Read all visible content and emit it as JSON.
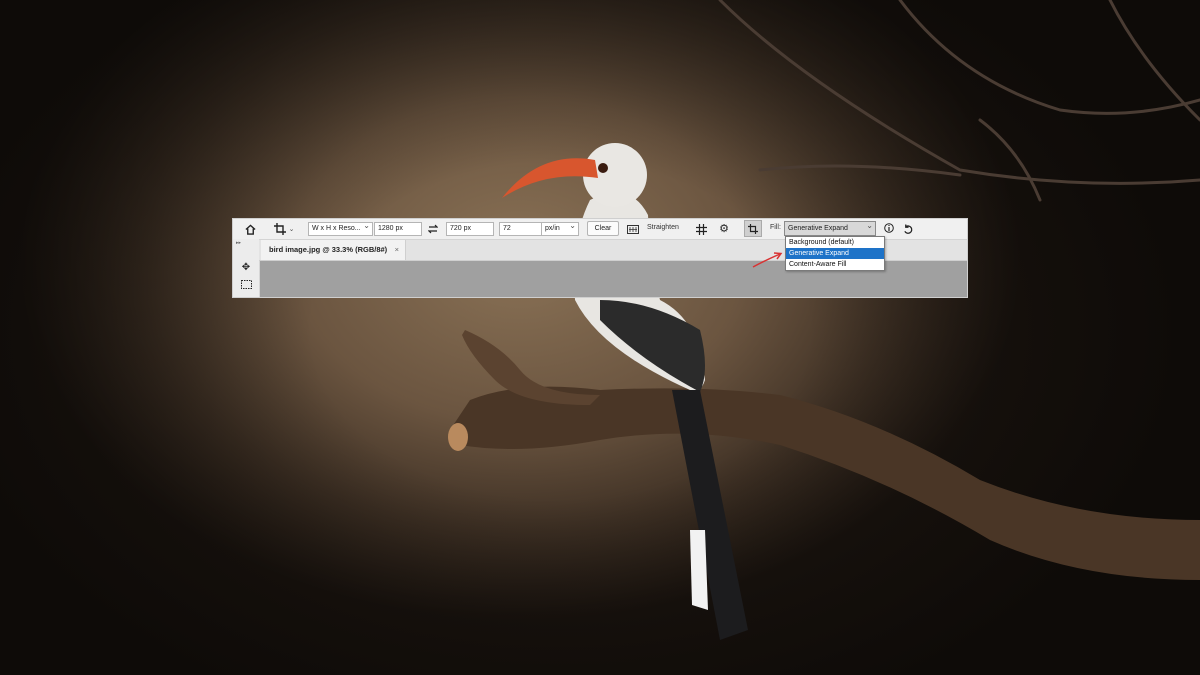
{
  "options_bar": {
    "home_icon": "home-icon",
    "crop_icon": "crop-icon",
    "ratio_preset": "W x H x Reso...",
    "width": "1280 px",
    "swap_icon": "swap-arrows-icon",
    "height": "720 px",
    "resolution": "72",
    "resolution_unit": "px/in",
    "clear_label": "Clear",
    "straighten_label": "Straighten",
    "grid_icon": "grid-overlay-icon",
    "settings_icon": "gear-icon",
    "content_aware_icon": "crop-fill-icon",
    "fill_label": "Fill:",
    "fill_value": "Generative Expand",
    "info_icon": "info-icon",
    "reset_icon": "reset-icon"
  },
  "fill_dropdown": {
    "options": [
      "Background (default)",
      "Generative Expand",
      "Content-Aware Fill"
    ],
    "selected_index": 1
  },
  "document_tab": {
    "title": "bird image.jpg @ 33.3% (RGB/8#)",
    "close": "×"
  },
  "tools": [
    "move-tool-icon",
    "marquee-tool-icon"
  ],
  "colors": {
    "accent": "#1e73c8",
    "annotation_arrow": "#d93232"
  }
}
